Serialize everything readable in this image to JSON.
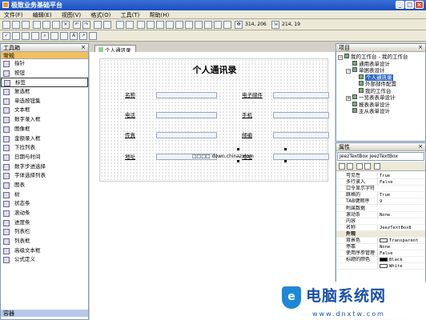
{
  "window": {
    "title": "极致业务基础平台"
  },
  "menu": [
    "文件(F)",
    "编辑(E)",
    "视图(V)",
    "格式(O)",
    "工具(T)",
    "帮助(H)"
  ],
  "toolbar": {
    "coords_pos": "314, 206",
    "coords_size": "214, 19"
  },
  "toolbox": {
    "title": "工具箱",
    "category": "常规",
    "footer": "容器",
    "items": [
      "指针",
      "按钮",
      "标签",
      "复选框",
      "单选按钮集",
      "文本框",
      "数字录入框",
      "图像框",
      "金额录入框",
      "下拉列表",
      "日期与时间",
      "数字步进选择",
      "字体选择列表",
      "图表",
      "树",
      "状态条",
      "滚动条",
      "进度条",
      "列表栏",
      "列表框",
      "高级文本框",
      "公式定义"
    ]
  },
  "document": {
    "tab": "个人通讯录",
    "title": "个人通讯录",
    "labels": [
      "名称",
      "电子邮件",
      "电话",
      "手机",
      "传真",
      "地址",
      "地址",
      "邮编"
    ],
    "watermark": "□□□□ down.chinaz.com"
  },
  "project": {
    "title": "项目",
    "tree": [
      "我的工作台 - 我的工作台",
      "通用表单设计",
      "单据表设计",
      "个人通讯录",
      "外部部件配置",
      "我的工作台",
      "一览表表单设计",
      "报表表单设计",
      "主从表单设计"
    ]
  },
  "properties": {
    "title": "属性",
    "object": "JeezTextBox JeezTextBox",
    "rows": [
      {
        "k": "可见性",
        "v": "True"
      },
      {
        "k": "多行录入",
        "v": "False"
      },
      {
        "k": "口令显示字符",
        "v": ""
      },
      {
        "k": "跳格的",
        "v": "True"
      },
      {
        "k": "TAB键顺序",
        "v": "9"
      },
      {
        "k": "附属数据",
        "v": ""
      },
      {
        "k": "滚动条",
        "v": "None"
      },
      {
        "k": "内容",
        "v": ""
      },
      {
        "k": "名称",
        "v": "JeezTextBox8"
      },
      {
        "k": "外观",
        "v": "",
        "group": true
      },
      {
        "k": "背景色",
        "v": "Transparent"
      },
      {
        "k": "停靠",
        "v": "None"
      },
      {
        "k": "使用序参管理",
        "v": "False"
      },
      {
        "k": "标题的颜色",
        "v": "Black"
      },
      {
        "k": "",
        "v": "White"
      }
    ]
  },
  "watermark_logo": {
    "main": "电脑系统网",
    "sub": "www.dnxtw.com",
    "accent": "#1a50a8"
  }
}
